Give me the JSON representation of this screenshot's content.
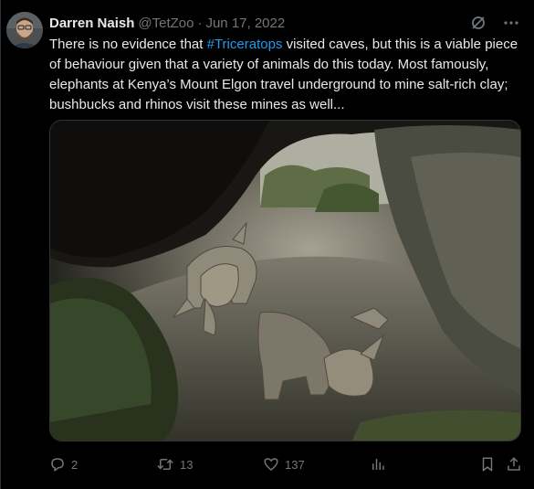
{
  "author": {
    "display_name": "Darren Naish",
    "handle": "@TetZoo",
    "separator": "·",
    "date": "Jun 17, 2022"
  },
  "tweet": {
    "text_before": "There is no evidence that ",
    "hashtag": "#Triceratops",
    "text_after": " visited caves, but this is a viable piece of behaviour given that a variety of animals do this today. Most famously, elephants at Kenya’s Mount Elgon travel underground to mine salt-rich clay; bushbucks and rhinos visit these mines as well..."
  },
  "actions": {
    "reply_count": "2",
    "retweet_count": "13",
    "like_count": "137"
  },
  "icons": {
    "grok": "grok-icon",
    "more": "more-icon",
    "reply": "reply-icon",
    "retweet": "retweet-icon",
    "like": "like-icon",
    "views": "views-icon",
    "bookmark": "bookmark-icon",
    "share": "share-icon"
  },
  "colors": {
    "background": "#000000",
    "text": "#e7e9ea",
    "secondary": "#71767b",
    "link": "#1d9bf0",
    "border": "#2f3336"
  }
}
